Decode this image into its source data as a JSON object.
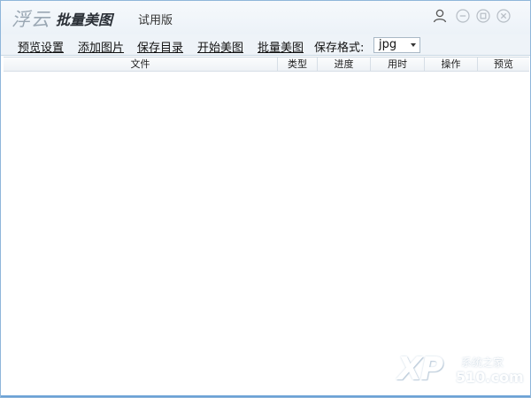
{
  "title": {
    "logo_part1": "浮云",
    "logo_part2": "批量美图",
    "edition": "试用版"
  },
  "window_controls": {
    "user": "user-icon",
    "minimize": "minimize-icon",
    "maximize": "maximize-icon",
    "close": "close-icon"
  },
  "toolbar": {
    "items": [
      "预览设置",
      "添加图片",
      "保存目录",
      "开始美图",
      "批量美图"
    ],
    "format_label": "保存格式:",
    "format_value": "jpg"
  },
  "table": {
    "columns": [
      "文件",
      "类型",
      "进度",
      "用时",
      "操作",
      "预览"
    ],
    "rows": []
  },
  "watermark": {
    "logo": "XP",
    "site_name": "系统之家",
    "domain": "510.com"
  },
  "colors": {
    "accent": "#6ca2d6",
    "window_border": "#8fb6da",
    "toolbar_bg": "#eef3f8",
    "titlebar_bg": "#f6f9fc"
  }
}
